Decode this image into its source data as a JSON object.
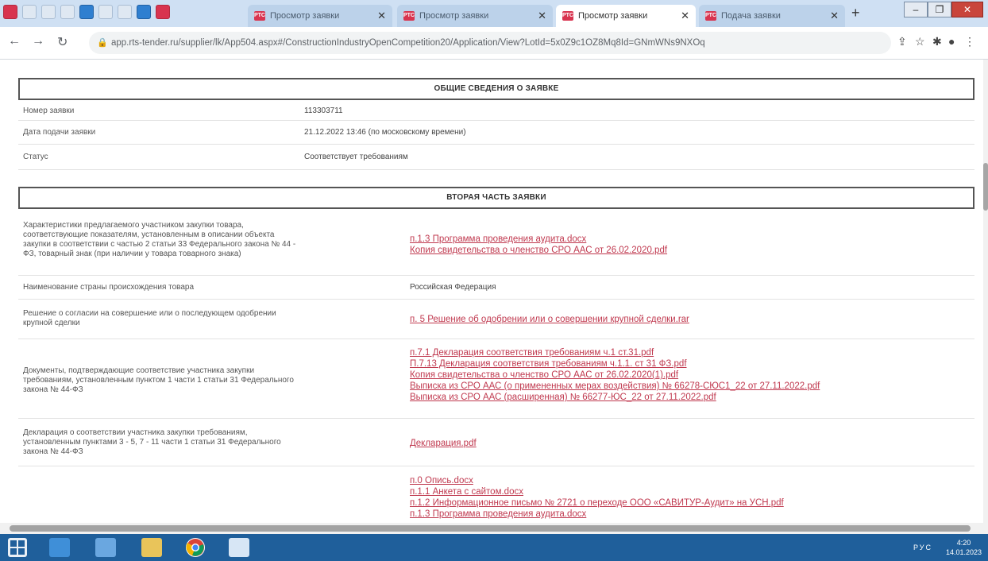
{
  "browser": {
    "tabs": [
      {
        "title": "Просмотр заявки",
        "active": false
      },
      {
        "title": "Просмотр заявки",
        "active": false
      },
      {
        "title": "Просмотр заявки",
        "active": true
      },
      {
        "title": "Подача заявки",
        "active": false
      }
    ],
    "url": "app.rts-tender.ru/supplier/lk/App504.aspx#/ConstructionIndustryOpenCompetition20/Application/View?LotId=5x0Z9c1OZ8Mq8Id=GNmWNs9NXOq",
    "window_controls": {
      "minimize": "–",
      "maximize": "❐",
      "close": "✕"
    }
  },
  "general": {
    "title": "ОБЩИЕ СВЕДЕНИЯ О ЗАЯВКЕ",
    "rows": [
      {
        "label": "Номер заявки",
        "value": "113303711"
      },
      {
        "label": "Дата подачи заявки",
        "value": "21.12.2022 13:46 (по московскому времени)"
      },
      {
        "label": "Статус",
        "value": "Соответствует требованиям"
      }
    ]
  },
  "second": {
    "title": "ВТОРАЯ ЧАСТЬ ЗАЯВКИ",
    "rows": [
      {
        "label_lines": [
          "Характеристики предлагаемого участником закупки товара,",
          "соответствующие показателям, установленным в описании объекта",
          "закупки в соответствии с частью 2 статьи 33 Федерального закона № 44 -",
          "ФЗ, товарный знак (при наличии у товара товарного знака)"
        ],
        "links": [
          "п.1.3 Программа проведения аудита.docx",
          "Копия свидетельства о членство СРО ААС от 26.02.2020.pdf"
        ]
      },
      {
        "label_lines": [
          "Наименование страны происхождения товара"
        ],
        "value": "Российская Федерация"
      },
      {
        "label_lines": [
          "Решение о согласии на совершение или о последующем одобрении",
          "крупной сделки"
        ],
        "links": [
          "п. 5 Решение об одобрении или о совершении крупной сделки.rar"
        ]
      },
      {
        "label_lines": [
          "Документы, подтверждающие соответствие участника закупки",
          "требованиям, установленным пунктом 1 части 1 статьи 31 Федерального",
          "закона № 44-ФЗ"
        ],
        "links": [
          "п.7.1 Декларация соответствия требованиям ч.1 ст.31.pdf",
          "П.7.13 Декларация соответствия требованиям ч.1.1. ст 31 ФЗ.pdf",
          "Копия свидетельства о членство СРО ААС от 26.02.2020(1).pdf",
          "Выписка из СРО ААС (о примененных мерах воздействия) № 66278-СЮС1_22 от 27.11.2022.pdf",
          "Выписка из СРО ААС (расширенная) № 66277-ЮС_22 от 27.11.2022.pdf"
        ]
      },
      {
        "label_lines": [
          "Декларация о соответствии участника закупки требованиям,",
          "установленным пунктами 3 - 5, 7 - 11 части 1 статьи 31 Федерального",
          "закона № 44-ФЗ"
        ],
        "links": [
          "Декларация.pdf"
        ]
      },
      {
        "label_lines": [],
        "links": [
          "п.0 Опись.docx",
          "п.1.1 Анкета с сайтом.docx",
          "п.1.2 Информационное письмо № 2721 о переходе ООО «САВИТУР-Аудит» на УСН.pdf",
          "п.1.3 Программа проведения аудита.docx"
        ]
      }
    ]
  },
  "taskbar": {
    "tray_lang": "РУС",
    "time": "4:20",
    "date": "14.01.2023"
  }
}
